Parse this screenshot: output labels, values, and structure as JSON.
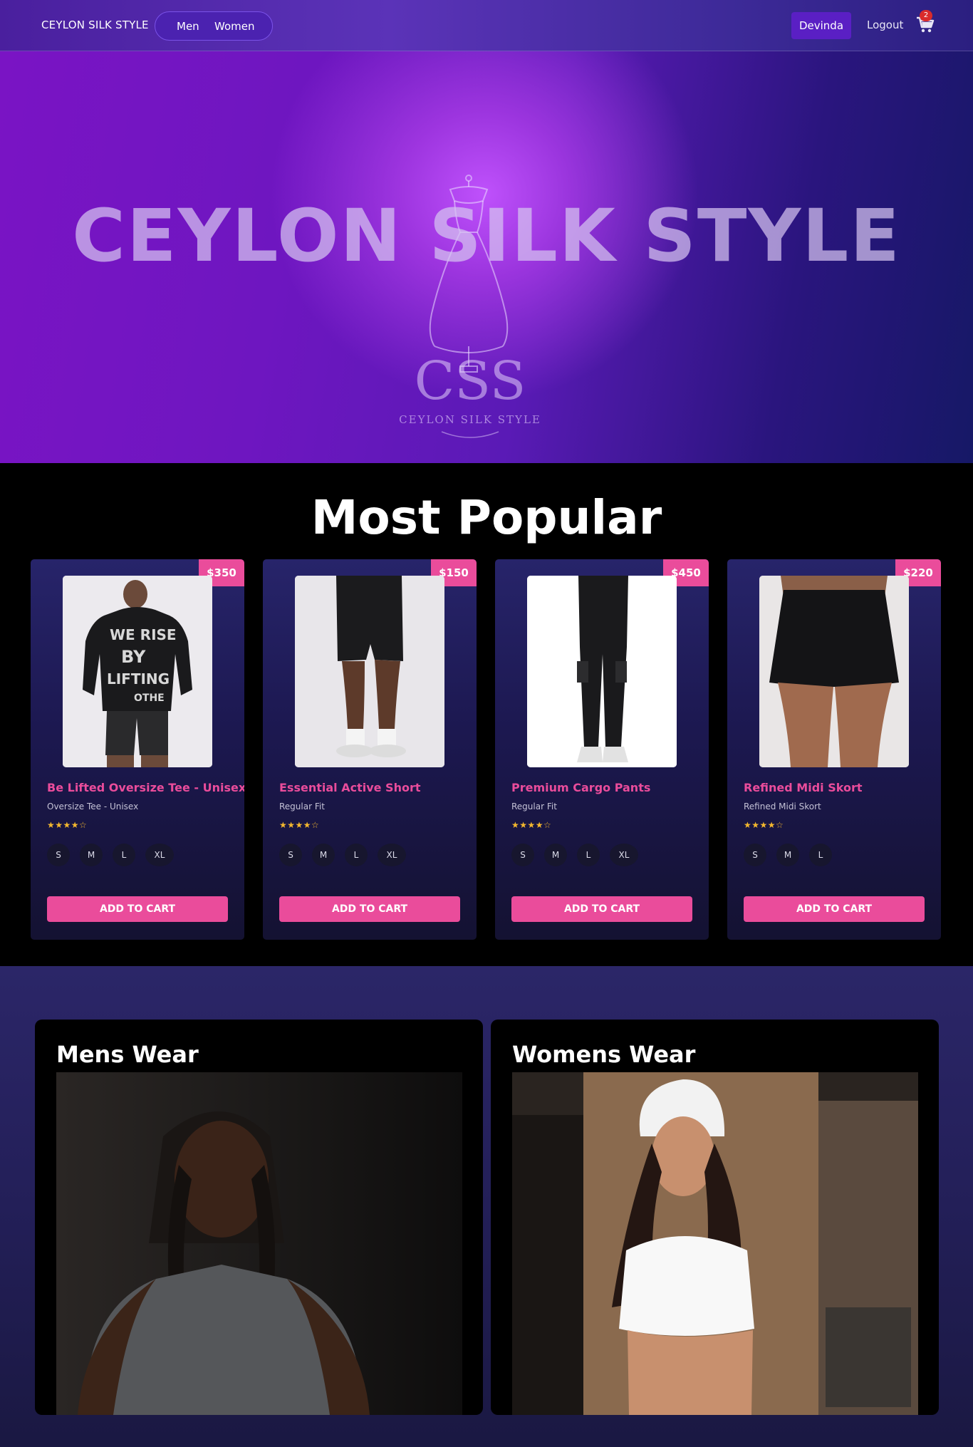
{
  "nav": {
    "brand": "CEYLON SILK STYLE",
    "links": [
      "Men",
      "Women"
    ],
    "user": "Devinda",
    "logout": "Logout",
    "cart_count": "2",
    "icons": {
      "cart": "cart-icon"
    }
  },
  "hero": {
    "title": "CEYLON SILK STYLE",
    "logo_mark": "CSS",
    "logo_text": "CEYLON SILK STYLE"
  },
  "popular": {
    "title": "Most Popular",
    "products": [
      {
        "price": "$350",
        "name": "Be Lifted Oversize Tee - Unisex",
        "sub": "Oversize Tee - Unisex",
        "rating": "★★★★☆",
        "sizes": [
          "S",
          "M",
          "L",
          "XL"
        ],
        "cta": "ADD TO CART",
        "print": [
          "WE RISE",
          "BY",
          "LIFTING",
          "OTHE"
        ]
      },
      {
        "price": "$150",
        "name": "Essential Active Short",
        "sub": "Regular Fit",
        "rating": "★★★★☆",
        "sizes": [
          "S",
          "M",
          "L",
          "XL"
        ],
        "cta": "ADD TO CART"
      },
      {
        "price": "$450",
        "name": "Premium Cargo Pants",
        "sub": "Regular Fit",
        "rating": "★★★★☆",
        "sizes": [
          "S",
          "M",
          "L",
          "XL"
        ],
        "cta": "ADD TO CART"
      },
      {
        "price": "$220",
        "name": "Refined Midi Skort",
        "sub": "Refined Midi Skort",
        "rating": "★★★★☆",
        "sizes": [
          "S",
          "M",
          "L"
        ],
        "cta": "ADD TO CART"
      }
    ]
  },
  "categories": [
    {
      "title": "Mens Wear"
    },
    {
      "title": "Womens Wear"
    }
  ],
  "colors": {
    "accent": "#ea4c9b",
    "nav": "#4a1f9e",
    "hero": "#7a14c4",
    "user_btn": "#5a1fc4"
  }
}
